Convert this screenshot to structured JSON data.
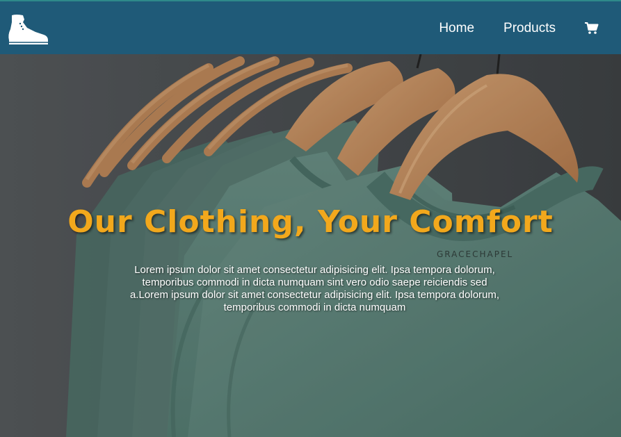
{
  "nav": {
    "logo_icon": "boot-icon",
    "links": [
      {
        "label": "Home"
      },
      {
        "label": "Products"
      }
    ],
    "cart_icon": "shopping-cart-icon"
  },
  "hero": {
    "title": "Our Clothing, Your Comfort",
    "text": "Lorem ipsum dolor sit amet consectetur adipisicing elit. Ipsa tempora dolorum, temporibus commodi in dicta numquam sint vero odio saepe reiciendis sed a.Lorem ipsum dolor sit amet consectetur adipisicing elit. Ipsa tempora dolorum, temporibus commodi in dicta numquam",
    "shirt_label": "GRACECHAPEL",
    "background_image": "green t-shirts on wooden hangers"
  },
  "colors": {
    "navbar": "#1f5a78",
    "title": "#f2a81c",
    "shirt": "#5f8b80",
    "hanger": "#c98f5c"
  }
}
